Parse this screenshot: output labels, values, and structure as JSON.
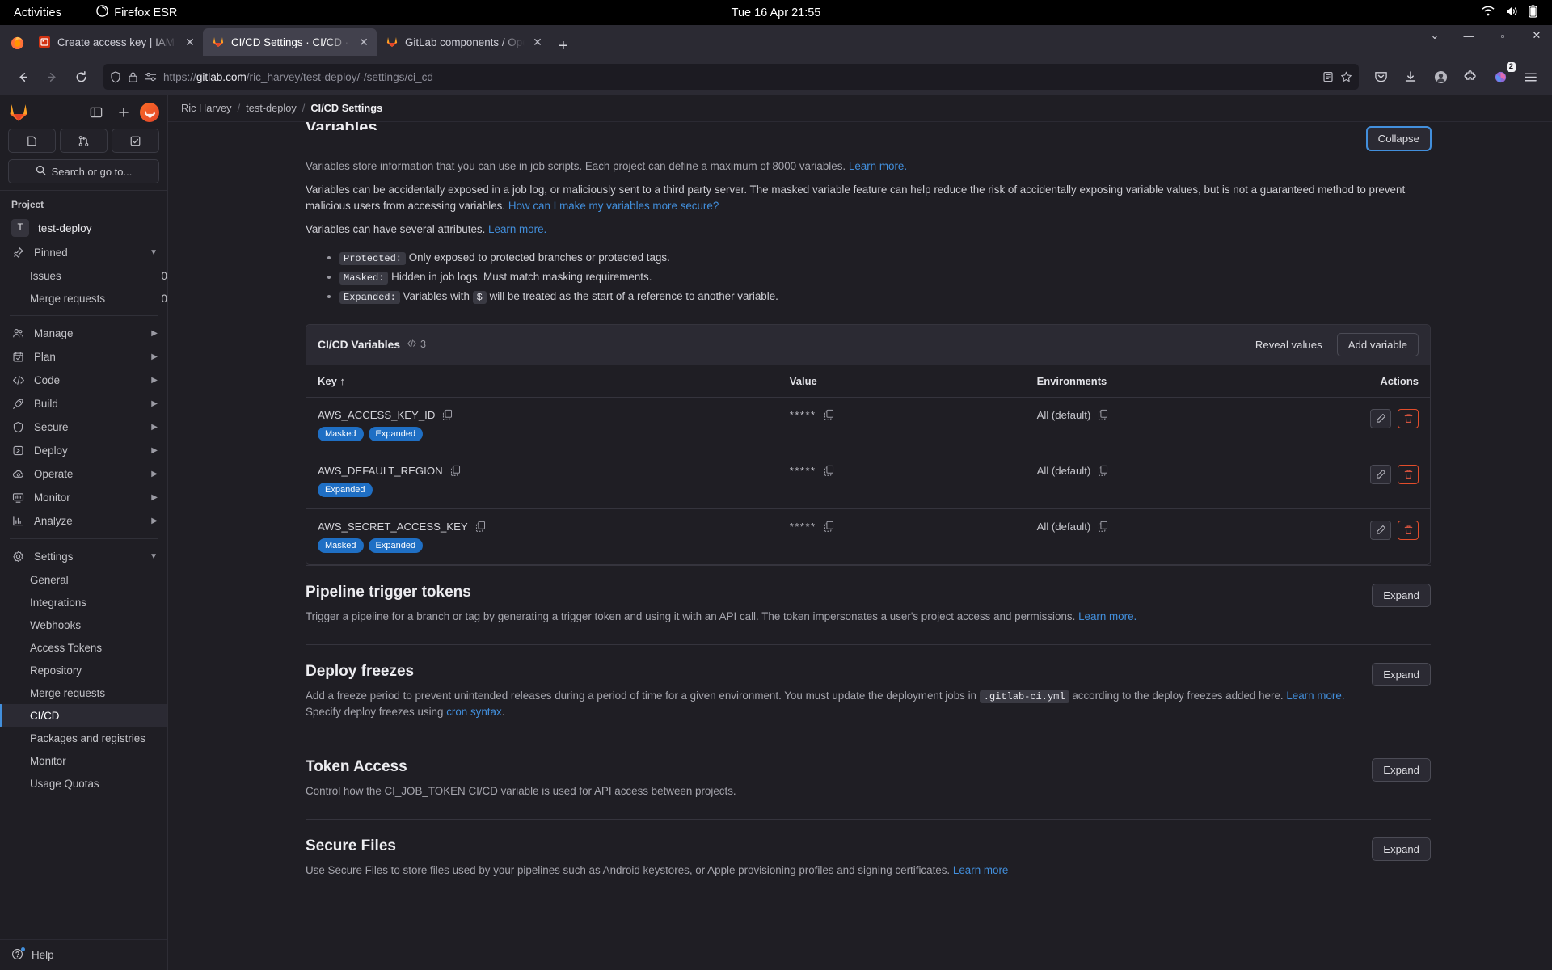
{
  "os_bar": {
    "activities": "Activities",
    "app_name": "Firefox ESR",
    "clock": "Tue 16 Apr  21:55",
    "tray_icons": [
      "wifi-icon",
      "volume-icon",
      "battery-icon"
    ]
  },
  "browser": {
    "tabs": [
      {
        "title": "Create access key | IAM | G",
        "favicon": "aws-icon",
        "active": false
      },
      {
        "title": "CI/CD Settings · CI/CD · Se",
        "favicon": "gitlab-icon",
        "active": true
      },
      {
        "title": "GitLab components / Ope",
        "favicon": "gitlab-icon",
        "active": false
      }
    ],
    "new_tab_label": "+",
    "url_display": {
      "scheme": "https://",
      "host": "gitlab.com",
      "path": "/ric_harvey/test-deploy/-/settings/ci_cd"
    },
    "url_full": "https://gitlab.com/ric_harvey/test-deploy/-/settings/ci_cd",
    "extension_badge_count": "2",
    "window_controls": {
      "minimize": "—",
      "maximize": "▫",
      "close": "✕",
      "list_tabs": "⌄"
    }
  },
  "sidebar": {
    "search_placeholder": "Search or go to...",
    "section_label": "Project",
    "project": {
      "initial": "T",
      "name": "test-deploy"
    },
    "pinned": {
      "label": "Pinned",
      "items": [
        {
          "label": "Issues",
          "badge": "0"
        },
        {
          "label": "Merge requests",
          "badge": "0"
        }
      ]
    },
    "groups": [
      {
        "label": "Manage",
        "icon": "users-icon"
      },
      {
        "label": "Plan",
        "icon": "calendar-icon"
      },
      {
        "label": "Code",
        "icon": "code-icon"
      },
      {
        "label": "Build",
        "icon": "rocket-icon"
      },
      {
        "label": "Secure",
        "icon": "shield-icon"
      },
      {
        "label": "Deploy",
        "icon": "deploy-icon"
      },
      {
        "label": "Operate",
        "icon": "cloud-gear-icon"
      },
      {
        "label": "Monitor",
        "icon": "monitor-icon"
      },
      {
        "label": "Analyze",
        "icon": "chart-icon"
      }
    ],
    "settings": {
      "label": "Settings",
      "icon": "gear-icon",
      "items": [
        {
          "label": "General",
          "active": false
        },
        {
          "label": "Integrations",
          "active": false
        },
        {
          "label": "Webhooks",
          "active": false
        },
        {
          "label": "Access Tokens",
          "active": false
        },
        {
          "label": "Repository",
          "active": false
        },
        {
          "label": "Merge requests",
          "active": false
        },
        {
          "label": "CI/CD",
          "active": true
        },
        {
          "label": "Packages and registries",
          "active": false
        },
        {
          "label": "Monitor",
          "active": false
        },
        {
          "label": "Usage Quotas",
          "active": false
        }
      ]
    },
    "help": {
      "label": "Help",
      "icon": "help-icon"
    }
  },
  "breadcrumb": {
    "items": [
      {
        "label": "Ric Harvey",
        "current": false
      },
      {
        "label": "test-deploy",
        "current": false
      },
      {
        "label": "CI/CD Settings",
        "current": true
      }
    ],
    "separator": "/"
  },
  "variables_section": {
    "title": "Variables",
    "collapse_label": "Collapse",
    "desc1_text": "Variables store information that you can use in job scripts. Each project can define a maximum of 8000 variables.",
    "desc1_link": "Learn more.",
    "desc2_text": "Variables can be accidentally exposed in a job log, or maliciously sent to a third party server. The masked variable feature can help reduce the risk of accidentally exposing variable values, but is not a guaranteed method to prevent malicious users from accessing variables.",
    "desc2_link": "How can I make my variables more secure?",
    "desc3_text": "Variables can have several attributes.",
    "desc3_link": "Learn more.",
    "attributes": [
      {
        "code": "Protected:",
        "text": "Only exposed to protected branches or protected tags."
      },
      {
        "code": "Masked:",
        "text": "Hidden in job logs. Must match masking requirements."
      },
      {
        "code": "Expanded:",
        "text_before": "Variables with",
        "code2": "$",
        "text_after": "will be treated as the start of a reference to another variable."
      }
    ]
  },
  "variables_table": {
    "card_title": "CI/CD Variables",
    "count": "3",
    "count_icon": "code-brackets-icon",
    "reveal_label": "Reveal values",
    "add_label": "Add variable",
    "columns": [
      "Key",
      "Value",
      "Environments",
      "Actions"
    ],
    "sort_indicator": "↑",
    "rows": [
      {
        "key": "AWS_ACCESS_KEY_ID",
        "chips": [
          "Masked",
          "Expanded"
        ],
        "value": "*****",
        "environment": "All (default)"
      },
      {
        "key": "AWS_DEFAULT_REGION",
        "chips": [
          "Expanded"
        ],
        "value": "*****",
        "environment": "All (default)"
      },
      {
        "key": "AWS_SECRET_ACCESS_KEY",
        "chips": [
          "Masked",
          "Expanded"
        ],
        "value": "*****",
        "environment": "All (default)"
      }
    ],
    "row_actions": {
      "edit": "edit-pencil-icon",
      "delete": "trash-icon"
    }
  },
  "sections": [
    {
      "title": "Pipeline trigger tokens",
      "expand_label": "Expand",
      "desc": "Trigger a pipeline for a branch or tag by generating a trigger token and using it with an API call. The token impersonates a user's project access and permissions.",
      "link": "Learn more."
    },
    {
      "title": "Deploy freezes",
      "expand_label": "Expand",
      "desc_a": "Add a freeze period to prevent unintended releases during a period of time for a given environment. You must update the deployment jobs in",
      "code": ".gitlab-ci.yml",
      "desc_b": "according to the deploy freezes added here.",
      "link1": "Learn more.",
      "desc_c": "Specify deploy freezes using",
      "link2": "cron syntax",
      "desc_d": "."
    },
    {
      "title": "Token Access",
      "expand_label": "Expand",
      "desc": "Control how the CI_JOB_TOKEN CI/CD variable is used for API access between projects."
    },
    {
      "title": "Secure Files",
      "expand_label": "Expand",
      "desc": "Use Secure Files to store files used by your pipelines such as Android keystores, or Apple provisioning profiles and signing certificates.",
      "link": "Learn more"
    }
  ],
  "colors": {
    "accent_blue": "#428fdc",
    "chip_blue": "#1f6fc4",
    "danger_red": "#ec5941",
    "bg": "#1f1e24",
    "panel": "#2b2a33"
  }
}
